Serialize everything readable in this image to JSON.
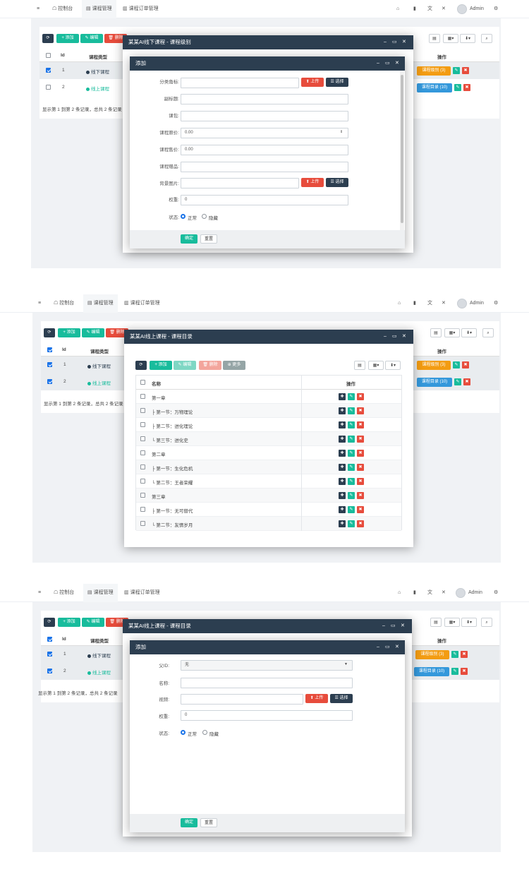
{
  "topbar": {
    "menu_icon": "≡",
    "tabs": [
      {
        "icon": "☖",
        "label": "控制台"
      },
      {
        "icon": "▤",
        "label": "课程管理"
      },
      {
        "icon": "▥",
        "label": "课程订单管理"
      }
    ],
    "right_icons": [
      "home-icon",
      "trash-icon",
      "translate-icon",
      "fullscreen-icon"
    ],
    "user": "Admin",
    "settings_icon": "⚙"
  },
  "toolbar": {
    "refresh": "⟳",
    "add": "+ 添加",
    "edit": "✎ 编辑",
    "delete": "🗑 删除",
    "more": "⊕ 更多"
  },
  "table": {
    "headers": [
      "Id",
      "课程类型",
      "操作"
    ],
    "rows": [
      {
        "id": "1",
        "type": "线下课程",
        "dot_color": "#2c3e50",
        "action": "课程级别 (3)",
        "action_color": "#f39c12"
      },
      {
        "id": "2",
        "type": "线上课程",
        "dot_color": "#18bc9c",
        "action": "课程目录 (10)",
        "action_color": "#3498db"
      }
    ],
    "summary": "显示第 1 到第 2 条记录，总共 2 条记录"
  },
  "shot1": {
    "outer_title": "某某AI线下课程 - 课程级别",
    "inner_title": "添加",
    "fields": [
      {
        "label": "分类角标:",
        "value": "",
        "buttons": true
      },
      {
        "label": "副标题:",
        "value": ""
      },
      {
        "label": "课包:",
        "value": ""
      },
      {
        "label": "课程原价:",
        "value": "0.00",
        "spinner": true
      },
      {
        "label": "课程售价:",
        "value": "0.00"
      },
      {
        "label": "课程赠品:",
        "value": ""
      },
      {
        "label": "背景图片:",
        "value": "",
        "buttons": true
      },
      {
        "label": "权重:",
        "value": "0"
      }
    ],
    "status_label": "状态:",
    "status_options": [
      "正常",
      "隐藏"
    ],
    "upload": "⬆ 上传",
    "choose": "☰ 选择",
    "ok": "确定",
    "reset": "重置"
  },
  "shot2": {
    "outer_title": "某某AI线上课程 - 课程目录",
    "headers": [
      "名称",
      "操作"
    ],
    "rows": [
      "第一章",
      "├ 第一节：万物理论",
      "├ 第二节：进化理论",
      "└ 第三节：进化史",
      "第二章",
      "├ 第一节：生化危机",
      "└ 第二节：王者荣耀",
      "第三章",
      "├ 第一节：无可替代",
      "└ 第二节：友情岁月"
    ]
  },
  "shot3": {
    "outer_title": "某某AI线上课程 - 课程目录",
    "inner_title": "添加",
    "parent_label": "父ID:",
    "parent_value": "无",
    "name_label": "名称:",
    "video_label": "视频:",
    "weight_label": "权重:",
    "weight_value": "0",
    "status_label": "状态:",
    "status_options": [
      "正常",
      "隐藏"
    ],
    "upload": "⬆ 上传",
    "choose": "☰ 选择",
    "ok": "确定",
    "reset": "重置"
  },
  "colors": {
    "navy": "#2c3e50",
    "teal": "#18bc9c",
    "red": "#e74c3c",
    "orange": "#f39c12",
    "blue": "#3498db"
  }
}
